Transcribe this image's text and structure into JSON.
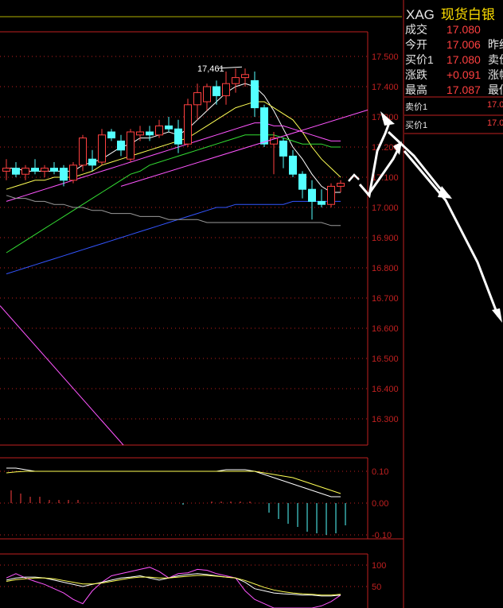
{
  "instrument": {
    "code": "XAG",
    "name": "现货白银"
  },
  "quote": [
    {
      "label": "成交",
      "value": "17.080",
      "label2": ""
    },
    {
      "label": "今开",
      "value": "17.006",
      "label2": "昨约"
    },
    {
      "label": "买价1",
      "value": "17.080",
      "label2": "卖价"
    },
    {
      "label": "涨跌",
      "value": "+0.091",
      "label2": "涨幅"
    },
    {
      "label": "最高",
      "value": "17.087",
      "label2": "最低"
    }
  ],
  "order_book": [
    {
      "label": "卖价1",
      "value": "17.0"
    },
    {
      "label": "买价1",
      "value": "17.0"
    }
  ],
  "colors": {
    "axis": "#c02020",
    "up": "#ff4040",
    "down": "#54ffff",
    "ma5": "#ffffff",
    "ma10": "#ffff55",
    "ma20": "#ff55ff",
    "ma30": "#33dd33",
    "ma60": "#3355ff",
    "ma120": "#9a9a9a"
  },
  "chart_data": [
    {
      "type": "candlestick",
      "title": "",
      "price_axis": {
        "min": 16.2,
        "max": 17.55,
        "ticks": [
          "17.500",
          "17.400",
          "17.300",
          "17.200",
          "17.100",
          "17.000",
          "16.900",
          "16.800",
          "16.700",
          "16.600",
          "16.500",
          "16.400",
          "16.300"
        ],
        "tick_values": [
          17.5,
          17.4,
          17.3,
          17.2,
          17.1,
          17.0,
          16.9,
          16.8,
          16.7,
          16.6,
          16.5,
          16.4,
          16.3
        ]
      },
      "annotation": {
        "text": "17,461",
        "price": 17.461
      },
      "candles": [
        [
          17.12,
          17.16,
          17.09,
          17.13
        ],
        [
          17.13,
          17.15,
          17.1,
          17.11
        ],
        [
          17.11,
          17.14,
          17.09,
          17.13
        ],
        [
          17.13,
          17.16,
          17.11,
          17.12
        ],
        [
          17.12,
          17.14,
          17.1,
          17.13
        ],
        [
          17.13,
          17.15,
          17.11,
          17.12
        ],
        [
          17.13,
          17.14,
          17.07,
          17.09
        ],
        [
          17.09,
          17.15,
          17.08,
          17.14
        ],
        [
          17.14,
          17.24,
          17.12,
          17.23
        ],
        [
          17.16,
          17.19,
          17.12,
          17.14
        ],
        [
          17.15,
          17.26,
          17.14,
          17.24
        ],
        [
          17.25,
          17.26,
          17.22,
          17.23
        ],
        [
          17.22,
          17.24,
          17.17,
          17.19
        ],
        [
          17.16,
          17.26,
          17.15,
          17.25
        ],
        [
          17.24,
          17.27,
          17.22,
          17.25
        ],
        [
          17.25,
          17.27,
          17.22,
          17.24
        ],
        [
          17.24,
          17.29,
          17.23,
          17.27
        ],
        [
          17.27,
          17.3,
          17.25,
          17.26
        ],
        [
          17.26,
          17.29,
          17.18,
          17.21
        ],
        [
          17.21,
          17.36,
          17.2,
          17.34
        ],
        [
          17.34,
          17.41,
          17.29,
          17.38
        ],
        [
          17.35,
          17.41,
          17.32,
          17.4
        ],
        [
          17.4,
          17.42,
          17.34,
          17.37
        ],
        [
          17.37,
          17.45,
          17.34,
          17.41
        ],
        [
          17.41,
          17.46,
          17.38,
          17.43
        ],
        [
          17.43,
          17.46,
          17.4,
          17.44
        ],
        [
          17.42,
          17.45,
          17.3,
          17.33
        ],
        [
          17.33,
          17.34,
          17.2,
          17.21
        ],
        [
          17.21,
          17.25,
          17.11,
          17.23
        ],
        [
          17.22,
          17.23,
          17.13,
          17.17
        ],
        [
          17.17,
          17.19,
          17.1,
          17.11
        ],
        [
          17.11,
          17.12,
          17.03,
          17.06
        ],
        [
          17.06,
          17.09,
          16.96,
          17.02
        ],
        [
          17.02,
          17.06,
          17.0,
          17.01
        ],
        [
          17.01,
          17.08,
          17.0,
          17.07
        ],
        [
          17.07,
          17.09,
          17.05,
          17.08
        ]
      ],
      "moving_averages": [
        {
          "name": "MA5",
          "color_key": "ma5",
          "values": [
            17.13,
            17.13,
            17.12,
            17.12,
            17.12,
            17.12,
            17.12,
            17.12,
            17.14,
            17.15,
            17.16,
            17.18,
            17.2,
            17.21,
            17.23,
            17.23,
            17.24,
            17.25,
            17.24,
            17.26,
            17.29,
            17.32,
            17.35,
            17.38,
            17.4,
            17.41,
            17.4,
            17.37,
            17.32,
            17.26,
            17.2,
            17.16,
            17.11,
            17.07,
            17.05,
            17.05
          ]
        },
        {
          "name": "MA10",
          "color_key": "ma10",
          "values": [
            17.06,
            17.07,
            17.08,
            17.09,
            17.09,
            17.1,
            17.1,
            17.1,
            17.11,
            17.12,
            17.14,
            17.15,
            17.16,
            17.17,
            17.18,
            17.19,
            17.2,
            17.21,
            17.22,
            17.23,
            17.25,
            17.27,
            17.29,
            17.31,
            17.33,
            17.34,
            17.35,
            17.35,
            17.33,
            17.31,
            17.29,
            17.25,
            17.2,
            17.16,
            17.13,
            17.1
          ]
        },
        {
          "name": "MA20",
          "color_key": "ma20",
          "values": [
            17.02,
            17.03,
            17.04,
            17.05,
            17.06,
            17.07,
            17.08,
            17.09,
            17.1,
            17.11,
            17.12,
            17.13,
            17.14,
            17.15,
            17.16,
            17.17,
            17.18,
            17.19,
            17.2,
            17.21,
            17.22,
            17.23,
            17.24,
            17.25,
            17.26,
            17.27,
            17.28,
            17.28,
            17.27,
            17.27,
            17.26,
            17.25,
            17.24,
            17.23,
            17.22,
            17.22
          ]
        },
        {
          "name": "MA30",
          "color_key": "ma30",
          "values": [
            16.85,
            16.87,
            16.89,
            16.91,
            16.93,
            16.95,
            16.97,
            16.99,
            17.01,
            17.03,
            17.05,
            17.07,
            17.09,
            17.11,
            17.12,
            17.14,
            17.15,
            17.16,
            17.17,
            17.18,
            17.19,
            17.2,
            17.21,
            17.22,
            17.23,
            17.24,
            17.24,
            17.24,
            17.24,
            17.23,
            17.22,
            17.21,
            17.21,
            17.21,
            17.2,
            17.2
          ]
        },
        {
          "name": "MA60",
          "color_key": "ma60",
          "values": [
            16.78,
            16.79,
            16.8,
            16.81,
            16.82,
            16.83,
            16.84,
            16.85,
            16.86,
            16.87,
            16.88,
            16.89,
            16.9,
            16.91,
            16.92,
            16.93,
            16.94,
            16.95,
            16.96,
            16.97,
            16.98,
            16.99,
            17.0,
            17.0,
            17.01,
            17.01,
            17.01,
            17.01,
            17.01,
            17.01,
            17.02,
            17.02,
            17.02,
            17.02,
            17.02,
            17.02
          ]
        },
        {
          "name": "MA120",
          "color_key": "ma120",
          "values": [
            17.04,
            17.03,
            17.03,
            17.02,
            17.02,
            17.01,
            17.01,
            17.0,
            17.0,
            16.99,
            16.99,
            16.98,
            16.98,
            16.98,
            16.97,
            16.97,
            16.97,
            16.96,
            16.96,
            16.96,
            16.96,
            16.95,
            16.95,
            16.95,
            16.95,
            16.95,
            16.95,
            16.95,
            16.95,
            16.95,
            16.95,
            16.95,
            16.95,
            16.95,
            16.94,
            16.94
          ]
        }
      ],
      "trendline_up": [
        [
          17.07,
          17.42
        ],
        [
          17.36,
          17.52
        ]
      ],
      "trendline_down": [
        [
          16.68,
          16.28
        ]
      ]
    },
    {
      "type": "bar",
      "title": "",
      "axis": {
        "min": -0.11,
        "max": 0.12,
        "ticks": [
          "0.10",
          "0.00",
          "-0.10"
        ],
        "tick_values": [
          0.1,
          0.0,
          -0.1
        ]
      },
      "histogram": [
        0.04,
        0.03,
        0.02,
        0.02,
        0.01,
        0.01,
        0.01,
        0.01,
        0.0,
        0.0,
        0.0,
        0.0,
        0.0,
        0.0,
        0.0,
        0.0,
        0.0,
        0.0,
        -0.005,
        0.0,
        0.0,
        0.005,
        0.005,
        0.005,
        0.005,
        0.005,
        0.0,
        -0.03,
        -0.05,
        -0.065,
        -0.075,
        -0.09,
        -0.095,
        -0.1,
        -0.095,
        -0.07
      ],
      "line_white": [
        0.11,
        0.11,
        0.105,
        0.1,
        0.1,
        0.1,
        0.1,
        0.1,
        0.1,
        0.1,
        0.1,
        0.1,
        0.1,
        0.1,
        0.1,
        0.1,
        0.1,
        0.1,
        0.1,
        0.1,
        0.1,
        0.1,
        0.1,
        0.105,
        0.105,
        0.105,
        0.1,
        0.09,
        0.08,
        0.07,
        0.06,
        0.05,
        0.04,
        0.03,
        0.02,
        0.02
      ],
      "line_yellow": [
        0.095,
        0.098,
        0.1,
        0.1,
        0.1,
        0.1,
        0.1,
        0.1,
        0.1,
        0.1,
        0.1,
        0.1,
        0.1,
        0.1,
        0.1,
        0.1,
        0.1,
        0.1,
        0.1,
        0.1,
        0.1,
        0.1,
        0.1,
        0.1,
        0.1,
        0.1,
        0.1,
        0.095,
        0.09,
        0.085,
        0.08,
        0.07,
        0.06,
        0.05,
        0.04,
        0.03
      ]
    },
    {
      "type": "line",
      "title": "",
      "axis": {
        "min": 0,
        "max": 110,
        "ticks": [
          "100",
          "50"
        ],
        "tick_values": [
          100,
          50
        ]
      },
      "series_white": [
        65,
        70,
        72,
        72,
        70,
        65,
        60,
        55,
        50,
        55,
        60,
        65,
        70,
        72,
        75,
        70,
        65,
        70,
        75,
        78,
        80,
        78,
        75,
        72,
        70,
        60,
        45,
        40,
        35,
        33,
        32,
        30,
        30,
        28,
        28,
        30
      ],
      "series_yellow": [
        62,
        66,
        68,
        70,
        70,
        68,
        64,
        60,
        56,
        56,
        58,
        62,
        66,
        70,
        72,
        72,
        70,
        70,
        72,
        74,
        76,
        76,
        74,
        72,
        70,
        64,
        56,
        48,
        42,
        38,
        35,
        33,
        32,
        30,
        30,
        32
      ],
      "series_magenta": [
        70,
        80,
        70,
        62,
        55,
        45,
        35,
        20,
        10,
        40,
        60,
        75,
        80,
        85,
        90,
        95,
        85,
        70,
        80,
        82,
        90,
        88,
        80,
        75,
        70,
        40,
        20,
        10,
        0,
        0,
        0,
        0,
        0,
        5,
        15,
        30
      ]
    }
  ]
}
